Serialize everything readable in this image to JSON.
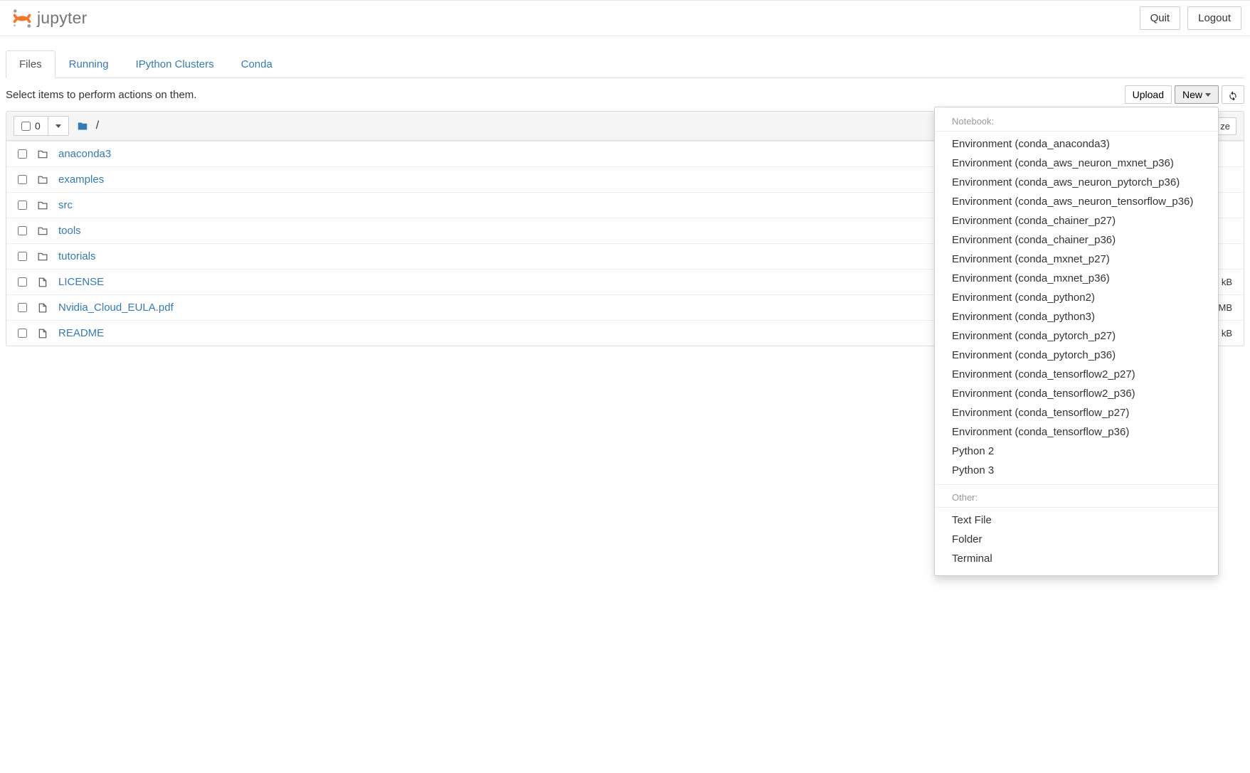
{
  "header": {
    "logo_text": "jupyter",
    "quit_label": "Quit",
    "logout_label": "Logout"
  },
  "tabs": [
    {
      "label": "Files",
      "active": true
    },
    {
      "label": "Running",
      "active": false
    },
    {
      "label": "IPython Clusters",
      "active": false
    },
    {
      "label": "Conda",
      "active": false
    }
  ],
  "action_row": {
    "hint": "Select items to perform actions on them.",
    "upload_label": "Upload",
    "new_label": "New"
  },
  "breadcrumb": {
    "selected_count": "0",
    "path_separator": "/",
    "size_peek": "ze"
  },
  "files": [
    {
      "type": "folder",
      "name": "anaconda3",
      "size": ""
    },
    {
      "type": "folder",
      "name": "examples",
      "size": ""
    },
    {
      "type": "folder",
      "name": "src",
      "size": ""
    },
    {
      "type": "folder",
      "name": "tools",
      "size": ""
    },
    {
      "type": "folder",
      "name": "tutorials",
      "size": ""
    },
    {
      "type": "file",
      "name": "LICENSE",
      "size": "kB"
    },
    {
      "type": "file",
      "name": "Nvidia_Cloud_EULA.pdf",
      "size": "MB"
    },
    {
      "type": "file",
      "name": "README",
      "size": "kB"
    }
  ],
  "new_menu": {
    "section_notebook": "Notebook:",
    "notebook_items": [
      "Environment (conda_anaconda3)",
      "Environment (conda_aws_neuron_mxnet_p36)",
      "Environment (conda_aws_neuron_pytorch_p36)",
      "Environment (conda_aws_neuron_tensorflow_p36)",
      "Environment (conda_chainer_p27)",
      "Environment (conda_chainer_p36)",
      "Environment (conda_mxnet_p27)",
      "Environment (conda_mxnet_p36)",
      "Environment (conda_python2)",
      "Environment (conda_python3)",
      "Environment (conda_pytorch_p27)",
      "Environment (conda_pytorch_p36)",
      "Environment (conda_tensorflow2_p27)",
      "Environment (conda_tensorflow2_p36)",
      "Environment (conda_tensorflow_p27)",
      "Environment (conda_tensorflow_p36)",
      "Python 2",
      "Python 3"
    ],
    "section_other": "Other:",
    "other_items": [
      "Text File",
      "Folder",
      "Terminal"
    ]
  }
}
